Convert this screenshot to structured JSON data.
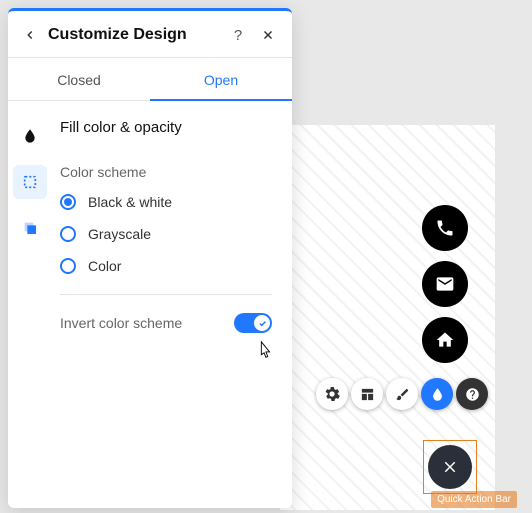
{
  "panel": {
    "title": "Customize Design",
    "tabs": {
      "closed": "Closed",
      "open": "Open"
    }
  },
  "section": {
    "title": "Fill color & opacity",
    "color_scheme_label": "Color scheme",
    "options": {
      "bw": "Black & white",
      "grayscale": "Grayscale",
      "color": "Color"
    },
    "invert_label": "Invert color scheme",
    "invert_on": true,
    "selected_option": "bw"
  },
  "badge": {
    "label": "Quick Action Bar"
  },
  "colors": {
    "accent": "#2277ff",
    "fab": "#000000",
    "close_fab": "#2a2f3a",
    "selection": "#e67e22"
  }
}
